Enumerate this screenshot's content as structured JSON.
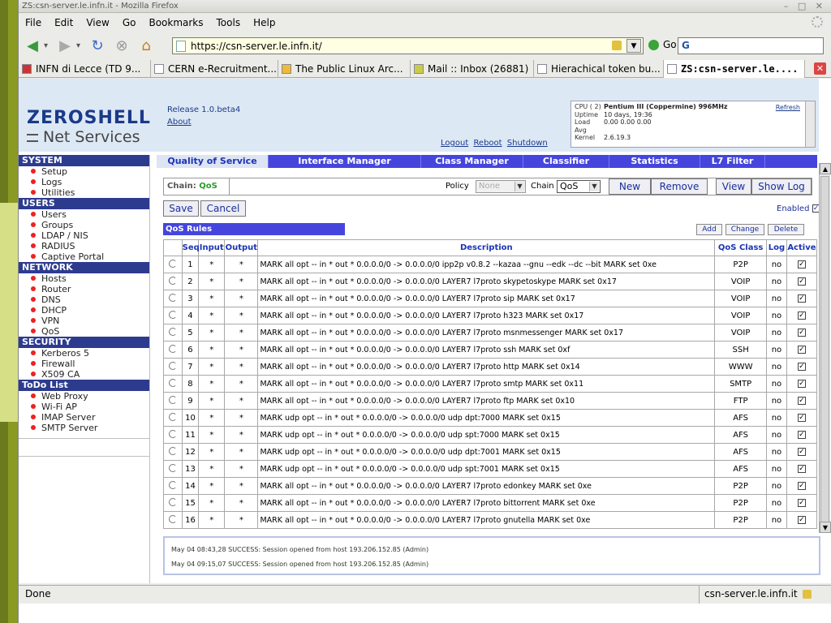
{
  "browser": {
    "title": "ZS:csn-server.le.infn.it - Mozilla Firefox",
    "menu": [
      "File",
      "Edit",
      "View",
      "Go",
      "Bookmarks",
      "Tools",
      "Help"
    ],
    "url": "https://csn-server.le.infn.it/",
    "go_label": "Go",
    "search_value": "G",
    "tabs": [
      {
        "label": "INFN di Lecce (TD 9..."
      },
      {
        "label": "CERN e-Recruitment..."
      },
      {
        "label": "The Public Linux Arc..."
      },
      {
        "label": "Mail :: Inbox (26881)"
      },
      {
        "label": "Hierachical token bu..."
      },
      {
        "label": "ZS:csn-server.le...."
      }
    ],
    "status": "Done",
    "status_host": "csn-server.le.infn.it"
  },
  "zs": {
    "logo": "ZEROSHELL",
    "subtitle": "Net Services",
    "release": "Release 1.0.beta4",
    "about": "About",
    "links": [
      "Logout",
      "Reboot",
      "Shutdown"
    ],
    "cpu": {
      "cpu_label": "CPU ( 2)",
      "cpu_value": "Pentium III (Coppermine) 996MHz",
      "uptime_label": "Uptime",
      "uptime_value": "10 days, 19:36",
      "load_label": "Load Avg",
      "load_value": "0.00 0.00 0.00",
      "kernel_label": "Kernel",
      "kernel_value": "2.6.19.3",
      "refresh": "Refresh"
    }
  },
  "sidebar": [
    {
      "head": "SYSTEM",
      "items": [
        "Setup",
        "Logs",
        "Utilities"
      ]
    },
    {
      "head": "USERS",
      "items": [
        "Users",
        "Groups",
        "LDAP / NIS",
        "RADIUS",
        "Captive Portal"
      ]
    },
    {
      "head": "NETWORK",
      "items": [
        "Hosts",
        "Router",
        "DNS",
        "DHCP",
        "VPN",
        "QoS"
      ]
    },
    {
      "head": "SECURITY",
      "items": [
        "Kerberos 5",
        "Firewall",
        "X509 CA"
      ]
    },
    {
      "head": "ToDo List",
      "items": [
        "Web Proxy",
        "Wi-Fi AP",
        "IMAP Server",
        "SMTP Server"
      ]
    }
  ],
  "main_tabs": [
    "Quality of Service",
    "Interface Manager",
    "Class Manager",
    "Classifier",
    "Statistics",
    "L7 Filter"
  ],
  "toolbar": {
    "chain_label": "Chain:",
    "chain_value": "QoS",
    "policy_label": "Policy",
    "policy_value": "None",
    "chain2_label": "Chain",
    "chain2_value": "QoS",
    "new": "New",
    "remove": "Remove",
    "view": "View",
    "show_log": "Show Log",
    "save": "Save",
    "cancel": "Cancel",
    "enabled": "Enabled",
    "rules_title": "QoS Rules",
    "add": "Add",
    "change": "Change",
    "delete": "Delete"
  },
  "table": {
    "headers": [
      "Seq",
      "Input",
      "Output",
      "Description",
      "QoS Class",
      "Log",
      "Active"
    ],
    "rows": [
      {
        "seq": "1",
        "in": "*",
        "out": "*",
        "desc": "MARK all opt -- in * out * 0.0.0.0/0 -> 0.0.0.0/0 ipp2p v0.8.2 --kazaa --gnu --edk --dc --bit MARK set 0xe",
        "cls": "P2P",
        "log": "no"
      },
      {
        "seq": "2",
        "in": "*",
        "out": "*",
        "desc": "MARK all opt -- in * out * 0.0.0.0/0 -> 0.0.0.0/0 LAYER7 l7proto skypetoskype MARK set 0x17",
        "cls": "VOIP",
        "log": "no"
      },
      {
        "seq": "3",
        "in": "*",
        "out": "*",
        "desc": "MARK all opt -- in * out * 0.0.0.0/0 -> 0.0.0.0/0 LAYER7 l7proto sip MARK set 0x17",
        "cls": "VOIP",
        "log": "no"
      },
      {
        "seq": "4",
        "in": "*",
        "out": "*",
        "desc": "MARK all opt -- in * out * 0.0.0.0/0 -> 0.0.0.0/0 LAYER7 l7proto h323 MARK set 0x17",
        "cls": "VOIP",
        "log": "no"
      },
      {
        "seq": "5",
        "in": "*",
        "out": "*",
        "desc": "MARK all opt -- in * out * 0.0.0.0/0 -> 0.0.0.0/0 LAYER7 l7proto msnmessenger MARK set 0x17",
        "cls": "VOIP",
        "log": "no"
      },
      {
        "seq": "6",
        "in": "*",
        "out": "*",
        "desc": "MARK all opt -- in * out * 0.0.0.0/0 -> 0.0.0.0/0 LAYER7 l7proto ssh MARK set 0xf",
        "cls": "SSH",
        "log": "no"
      },
      {
        "seq": "7",
        "in": "*",
        "out": "*",
        "desc": "MARK all opt -- in * out * 0.0.0.0/0 -> 0.0.0.0/0 LAYER7 l7proto http MARK set 0x14",
        "cls": "WWW",
        "log": "no"
      },
      {
        "seq": "8",
        "in": "*",
        "out": "*",
        "desc": "MARK all opt -- in * out * 0.0.0.0/0 -> 0.0.0.0/0 LAYER7 l7proto smtp MARK set 0x11",
        "cls": "SMTP",
        "log": "no"
      },
      {
        "seq": "9",
        "in": "*",
        "out": "*",
        "desc": "MARK all opt -- in * out * 0.0.0.0/0 -> 0.0.0.0/0 LAYER7 l7proto ftp MARK set 0x10",
        "cls": "FTP",
        "log": "no"
      },
      {
        "seq": "10",
        "in": "*",
        "out": "*",
        "desc": "MARK udp opt -- in * out * 0.0.0.0/0 -> 0.0.0.0/0 udp dpt:7000 MARK set 0x15",
        "cls": "AFS",
        "log": "no"
      },
      {
        "seq": "11",
        "in": "*",
        "out": "*",
        "desc": "MARK udp opt -- in * out * 0.0.0.0/0 -> 0.0.0.0/0 udp spt:7000 MARK set 0x15",
        "cls": "AFS",
        "log": "no"
      },
      {
        "seq": "12",
        "in": "*",
        "out": "*",
        "desc": "MARK udp opt -- in * out * 0.0.0.0/0 -> 0.0.0.0/0 udp dpt:7001 MARK set 0x15",
        "cls": "AFS",
        "log": "no"
      },
      {
        "seq": "13",
        "in": "*",
        "out": "*",
        "desc": "MARK udp opt -- in * out * 0.0.0.0/0 -> 0.0.0.0/0 udp spt:7001 MARK set 0x15",
        "cls": "AFS",
        "log": "no"
      },
      {
        "seq": "14",
        "in": "*",
        "out": "*",
        "desc": "MARK all opt -- in * out * 0.0.0.0/0 -> 0.0.0.0/0 LAYER7 l7proto edonkey MARK set 0xe",
        "cls": "P2P",
        "log": "no"
      },
      {
        "seq": "15",
        "in": "*",
        "out": "*",
        "desc": "MARK all opt -- in * out * 0.0.0.0/0 -> 0.0.0.0/0 LAYER7 l7proto bittorrent MARK set 0xe",
        "cls": "P2P",
        "log": "no"
      },
      {
        "seq": "16",
        "in": "*",
        "out": "*",
        "desc": "MARK all opt -- in * out * 0.0.0.0/0 -> 0.0.0.0/0 LAYER7 l7proto gnutella MARK set 0xe",
        "cls": "P2P",
        "log": "no"
      }
    ]
  },
  "log": [
    "May 04 08:43,28 SUCCESS: Session opened from host 193.206.152.85 (Admin)",
    "May 04 09:15,07 SUCCESS: Session opened from host 193.206.152.85 (Admin)"
  ],
  "colors": {
    "accent": "#4545dd",
    "sidebar_head": "#2d3b8f",
    "bullet": "#ee2222"
  }
}
